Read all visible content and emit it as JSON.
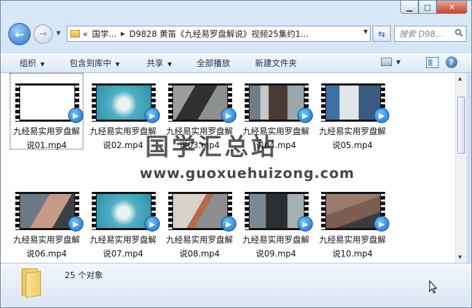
{
  "window": {
    "caption": {
      "minimize": "▁",
      "maximize": "□",
      "close": "✕"
    }
  },
  "nav": {
    "back_icon": "back-arrow-icon",
    "forward_icon": "forward-arrow-icon",
    "address": {
      "overflow": "«",
      "segments": [
        "国学...",
        "D9828 黄笛《九经易罗盘解说》视频25集约1..."
      ]
    },
    "search_placeholder": "搜索 D98..."
  },
  "toolbar": {
    "organize": "组织",
    "include_in_library": "包含到库中",
    "share": "共享",
    "play_all": "全部播放",
    "new_folder": "新建文件夹"
  },
  "files": [
    {
      "name": "九经易实用罗盘解说01.mp4",
      "selected": true
    },
    {
      "name": "九经易实用罗盘解说02.mp4",
      "selected": false
    },
    {
      "name": "九经易实用罗盘解说03.mp4",
      "selected": false
    },
    {
      "name": "九经易实用罗盘解说04.mp4",
      "selected": false
    },
    {
      "name": "九经易实用罗盘解说05.mp4",
      "selected": false
    },
    {
      "name": "九经易实用罗盘解说06.mp4",
      "selected": false
    },
    {
      "name": "九经易实用罗盘解说07.mp4",
      "selected": false
    },
    {
      "name": "九经易实用罗盘解说08.mp4",
      "selected": false
    },
    {
      "name": "九经易实用罗盘解说09.mp4",
      "selected": false
    },
    {
      "name": "九经易实用罗盘解说10.mp4",
      "selected": false
    }
  ],
  "watermark": {
    "cn": "国学汇总站",
    "url": "www.guoxuehuizong.com"
  },
  "status": {
    "count": "25 个对象"
  },
  "colors": {
    "accent": "#2a6fc4",
    "media_badge": "#1e6fc7",
    "close_button": "#c5432c"
  }
}
